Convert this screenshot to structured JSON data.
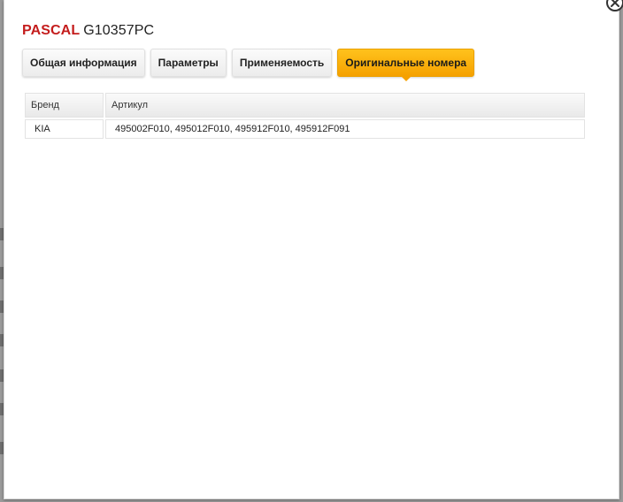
{
  "product": {
    "brand": "PASCAL",
    "code": "G10357PC"
  },
  "tabs": [
    {
      "label": "Общая информация",
      "active": false
    },
    {
      "label": "Параметры",
      "active": false
    },
    {
      "label": "Применяемость",
      "active": false
    },
    {
      "label": "Оригинальные номера",
      "active": true
    }
  ],
  "table": {
    "headers": [
      "Бренд",
      "Артикул"
    ],
    "rows": [
      {
        "brand": "KIA",
        "articles": "495002F010, 495012F010, 495912F010, 495912F091"
      }
    ]
  },
  "colors": {
    "brand_red": "#c41d1d",
    "active_tab": "#f5a100"
  },
  "icons": {
    "close": "close-icon"
  }
}
